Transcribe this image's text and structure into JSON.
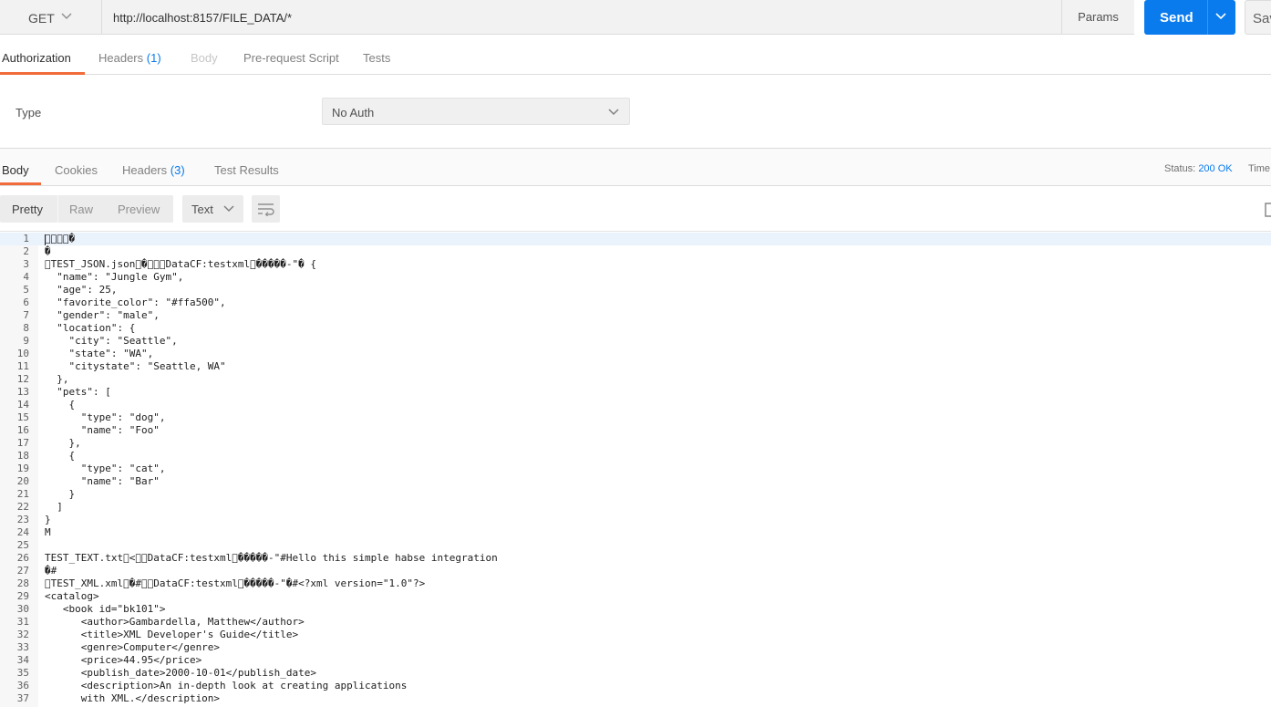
{
  "request": {
    "method": "GET",
    "url": "http://localhost:8157/FILE_DATA/*",
    "params_label": "Params",
    "send_label": "Send",
    "save_label": "Sav"
  },
  "request_tabs": [
    {
      "label": "Authorization",
      "count": ""
    },
    {
      "label": "Headers",
      "count": "(1)"
    },
    {
      "label": "Body",
      "count": ""
    },
    {
      "label": "Pre-request Script",
      "count": ""
    },
    {
      "label": "Tests",
      "count": ""
    }
  ],
  "auth": {
    "type_label": "Type",
    "selected": "No Auth"
  },
  "response_tabs": [
    {
      "label": "Body",
      "count": ""
    },
    {
      "label": "Cookies",
      "count": ""
    },
    {
      "label": "Headers",
      "count": "(3)"
    },
    {
      "label": "Test Results",
      "count": ""
    }
  ],
  "response_meta": {
    "status_label": "Status:",
    "status_value": "200 OK",
    "time_label": "Time:"
  },
  "view_modes": [
    "Pretty",
    "Raw",
    "Preview"
  ],
  "format": "Text",
  "colors": {
    "accent_blue": "#097bed",
    "tab_underline": "#f26b3a"
  },
  "code_lines": [
    "\u0000\u0000\u0000\u0000�",
    "�",
    "\u0000TEST_JSON.json\u0000�\u0000\u0000\u0000DataCF:testxml\u0000�����-\"� {",
    "  \"name\": \"Jungle Gym\",",
    "  \"age\": 25,",
    "  \"favorite_color\": \"#ffa500\",",
    "  \"gender\": \"male\",",
    "  \"location\": {",
    "    \"city\": \"Seattle\",",
    "    \"state\": \"WA\",",
    "    \"citystate\": \"Seattle, WA\"",
    "  },",
    "  \"pets\": [",
    "    {",
    "      \"type\": \"dog\",",
    "      \"name\": \"Foo\"",
    "    },",
    "    {",
    "      \"type\": \"cat\",",
    "      \"name\": \"Bar\"",
    "    }",
    "  ]",
    "}",
    "M",
    "",
    "TEST_TEXT.txt\u0000<\u0000\u0000DataCF:testxml\u0000�����-\"#Hello this simple habse integration",
    "�#",
    "\u0000TEST_XML.xml\u0000�#\u0000\u0000DataCF:testxml\u0000�����-\"�#<?xml version=\"1.0\"?>",
    "<catalog>",
    "   <book id=\"bk101\">",
    "      <author>Gambardella, Matthew</author>",
    "      <title>XML Developer's Guide</title>",
    "      <genre>Computer</genre>",
    "      <price>44.95</price>",
    "      <publish_date>2000-10-01</publish_date>",
    "      <description>An in-depth look at creating applications",
    "      with XML.</description>"
  ]
}
